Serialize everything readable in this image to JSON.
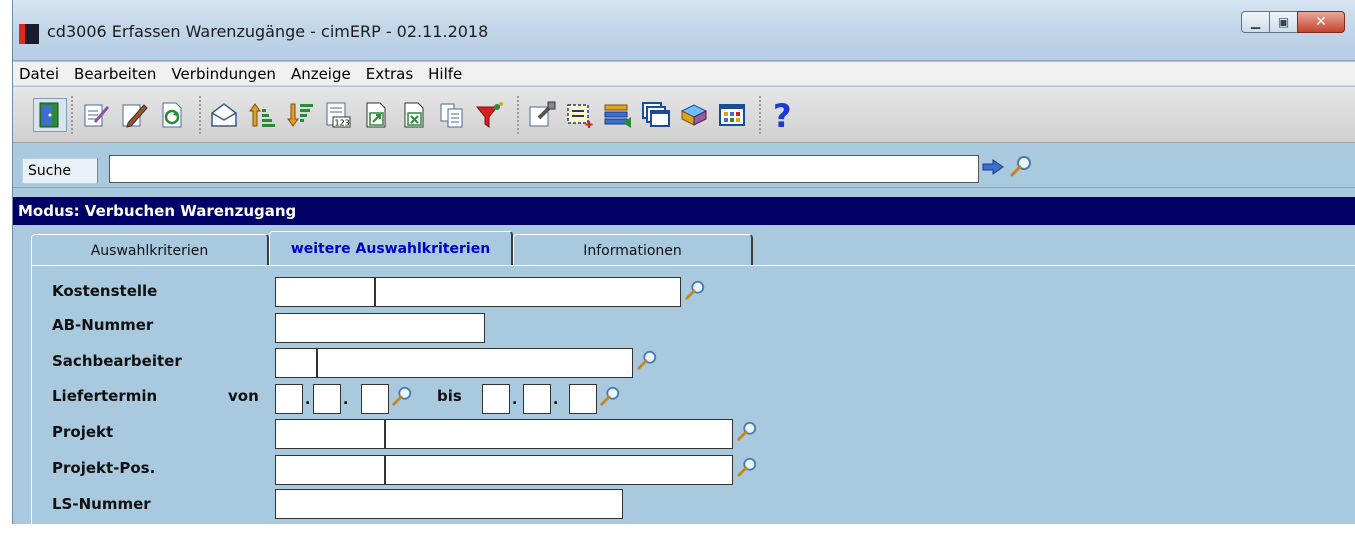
{
  "window": {
    "title": "cd3006 Erfassen Warenzugänge - cimERP - 02.11.2018",
    "controls": [
      "minimize-icon",
      "maximize-icon",
      "close-icon"
    ]
  },
  "menu": [
    {
      "label": "Datei"
    },
    {
      "label": "Bearbeiten"
    },
    {
      "label": "Verbindungen"
    },
    {
      "label": "Anzeige"
    },
    {
      "label": "Extras"
    },
    {
      "label": "Hilfe"
    }
  ],
  "toolbar": {
    "icons": [
      "exit-door-icon",
      "edit-checklist-icon",
      "edit-pencil-icon",
      "refresh-icon",
      "mail-icon",
      "sort-ascending-icon",
      "sort-descending-icon",
      "calculator-list-icon",
      "export-icon",
      "excel-export-icon",
      "copy-icon",
      "filter-icon",
      "properties-icon",
      "select-area-icon",
      "list-settings-icon",
      "windows-icon",
      "book-icon",
      "grid-icon",
      "help-icon"
    ]
  },
  "search": {
    "label": "Suche",
    "value": ""
  },
  "mode": "Modus: Verbuchen Warenzugang",
  "tabs": [
    {
      "label": "Auswahlkriterien"
    },
    {
      "label": "weitere Auswahlkriterien",
      "active": true
    },
    {
      "label": "Informationen"
    }
  ],
  "form": {
    "kostenstelle": "Kostenstelle",
    "ab_nummer": "AB-Nummer",
    "sachbearbeiter": "Sachbearbeiter",
    "liefertermin": "Liefertermin",
    "von": "von",
    "bis": "bis",
    "projekt": "Projekt",
    "projekt_pos": "Projekt-Pos.",
    "ls_nummer": "LS-Nummer",
    "date_separator": "."
  },
  "colors": {
    "background": "#a9c9de",
    "mode_bar": "#000066",
    "active_tab_text": "#0000cc"
  }
}
